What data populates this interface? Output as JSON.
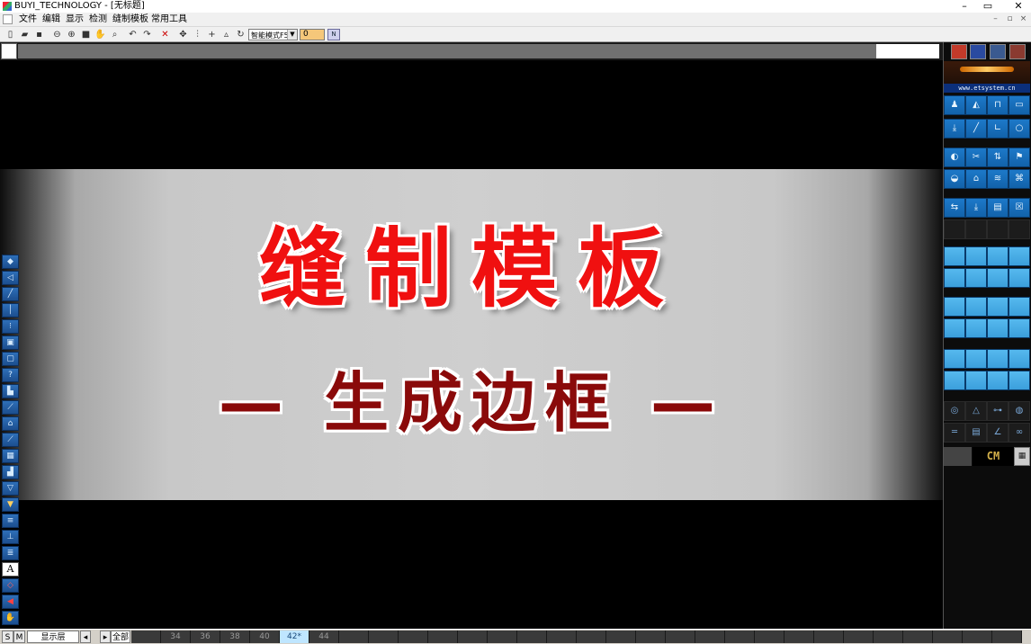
{
  "window": {
    "title": "BUYI_TECHNOLOGY - [无标题]",
    "controls": {
      "minimize": "–",
      "restore": "▭",
      "close": "✕"
    }
  },
  "menu": {
    "items": [
      "文件",
      "编辑",
      "显示",
      "检测",
      "缝制模板",
      "常用工具"
    ],
    "mdi_controls": [
      "–",
      "▫",
      "×"
    ]
  },
  "toolbar": {
    "mode_select": "智能模式F5",
    "number_value": "0",
    "color_button": "N"
  },
  "canvas": {
    "headline": "缝制模板",
    "subline": "— 生成边框 —"
  },
  "left_tools": {
    "text_tool_label": "A"
  },
  "right_panel": {
    "url": "www.etsystem.cn",
    "unit_button": "CM",
    "calculator_icon": "calculator-icon"
  },
  "statusbar": {
    "s_button": "S",
    "m_button": "M",
    "layer_label": "显示层",
    "prev": "◂",
    "next": "▸",
    "all_label": "全部",
    "sizes": [
      "34",
      "36",
      "38",
      "40",
      "42*",
      "44"
    ],
    "selected_size": "42*"
  },
  "colors": {
    "headline": "#f01010",
    "subline": "#8a0a0a",
    "tool_blue": "#1d79c9",
    "tool_light": "#56b9ee",
    "number_field": "#f5c77a"
  }
}
